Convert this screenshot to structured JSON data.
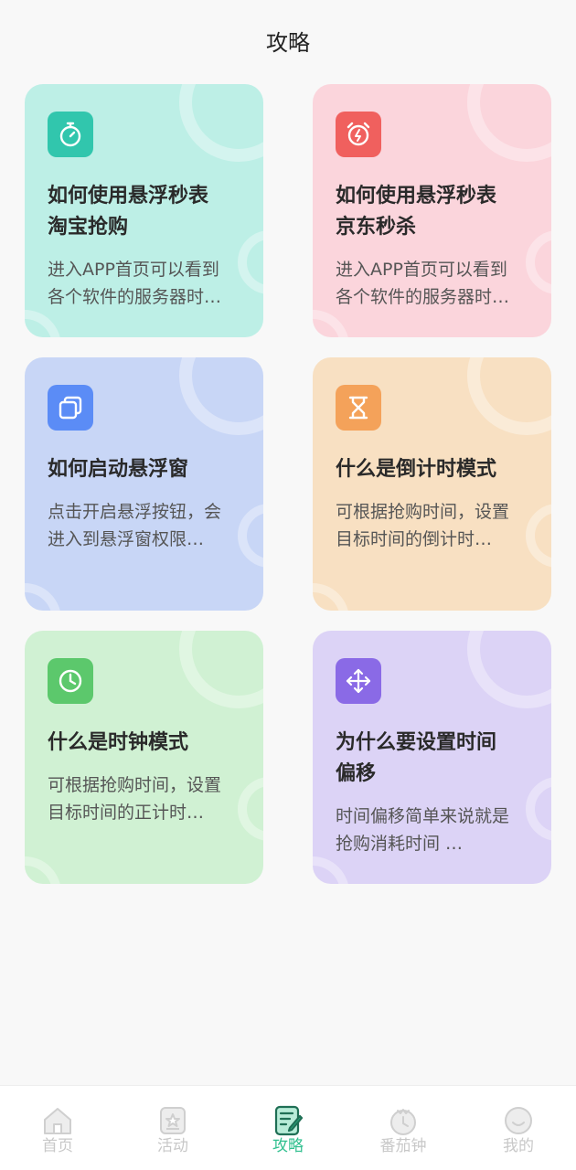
{
  "header": {
    "title": "攻略"
  },
  "cards": [
    {
      "title": "如何使用悬浮秒表\n淘宝抢购",
      "desc": "进入APP首页可以看到\n各个软件的服务器时…",
      "icon": "stopwatch-icon",
      "bg": "#bdefe6",
      "icon_bg": "#31c6ad"
    },
    {
      "title": "如何使用悬浮秒表\n京东秒杀",
      "desc": "进入APP首页可以看到\n各个软件的服务器时…",
      "icon": "alarm-clock-icon",
      "bg": "#fbd5dc",
      "icon_bg": "#f0605e"
    },
    {
      "title": "如何启动悬浮窗",
      "desc": "点击开启悬浮按钮，会\n进入到悬浮窗权限…",
      "icon": "floating-window-icon",
      "bg": "#c8d6f6",
      "icon_bg": "#5b8cf6"
    },
    {
      "title": "什么是倒计时模式",
      "desc": "可根据抢购时间，设置\n目标时间的倒计时…",
      "icon": "hourglass-icon",
      "bg": "#f8e0c2",
      "icon_bg": "#f4a25a"
    },
    {
      "title": "什么是时钟模式",
      "desc": "可根据抢购时间，设置\n目标时间的正计时…",
      "icon": "clock-icon",
      "bg": "#d0f1d3",
      "icon_bg": "#5cc86c"
    },
    {
      "title": "为什么要设置时间\n偏移",
      "desc": "时间偏移简单来说就是\n抢购消耗时间 …",
      "icon": "move-arrows-icon",
      "bg": "#dcd3f6",
      "icon_bg": "#8a6ae6"
    }
  ],
  "tabbar": {
    "items": [
      {
        "label": "首页",
        "icon": "home-icon",
        "active": false
      },
      {
        "label": "活动",
        "icon": "activity-icon",
        "active": false
      },
      {
        "label": "攻略",
        "icon": "guide-icon",
        "active": true
      },
      {
        "label": "番茄钟",
        "icon": "tomato-clock-icon",
        "active": false
      },
      {
        "label": "我的",
        "icon": "profile-icon",
        "active": false
      }
    ],
    "active_color": "#2fbf8e",
    "inactive_color": "#c8c8c8"
  }
}
